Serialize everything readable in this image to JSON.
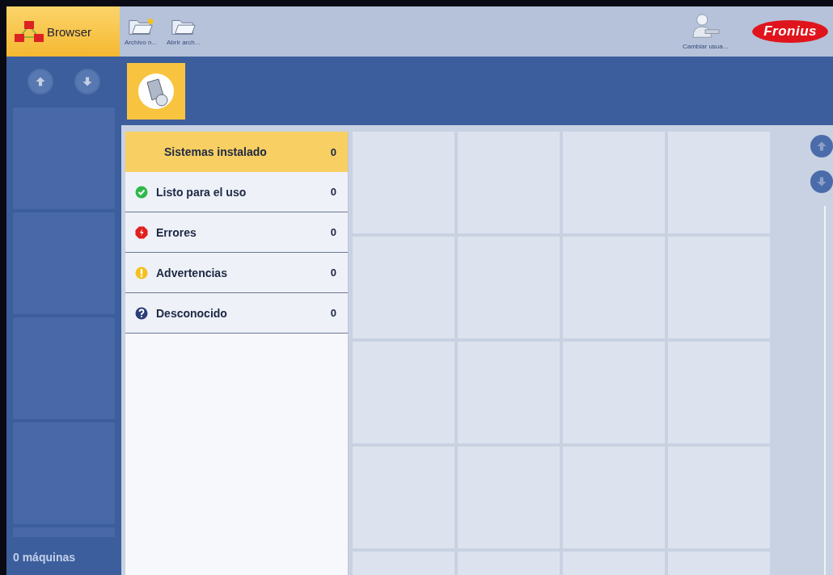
{
  "app_tab": {
    "label": "Browser",
    "selected": true
  },
  "toolbar": [
    {
      "label": "Archivo n...",
      "kind": "new-folder"
    },
    {
      "label": "Abrir arch...",
      "kind": "folder"
    }
  ],
  "user_button": {
    "label": "Cambiar usua..."
  },
  "logo": {
    "text": "Fronius"
  },
  "categories": [
    {
      "label": "Sistemas instalado",
      "count": "0",
      "kind": "all",
      "selected": true
    },
    {
      "label": "Listo para el uso",
      "count": "0",
      "kind": "ok",
      "selected": false
    },
    {
      "label": "Errores",
      "count": "0",
      "kind": "error",
      "selected": false
    },
    {
      "label": "Advertencias",
      "count": "0",
      "kind": "warning",
      "selected": false
    },
    {
      "label": "Desconocido",
      "count": "0",
      "kind": "unknown",
      "selected": false
    }
  ],
  "footer": {
    "machines": "0 máquinas"
  }
}
